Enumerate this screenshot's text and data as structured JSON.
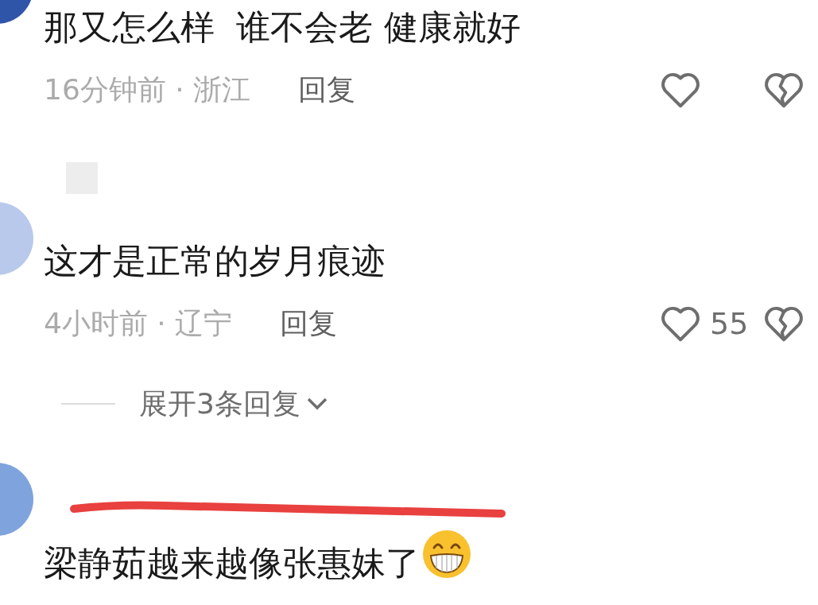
{
  "comments": [
    {
      "text": "那又怎么样  谁不会老 健康就好",
      "time": "16分钟前 · 浙江",
      "reply": "回复"
    },
    {
      "name_hidden": true,
      "text": "这才是正常的岁月痕迹",
      "time": "4小时前 · 辽宁",
      "reply": "回复",
      "likes": "55",
      "expand_label": "展开3条回复"
    },
    {
      "text": "梁静茹越来越像张惠妹了",
      "emoji": true,
      "stroke": true
    }
  ]
}
